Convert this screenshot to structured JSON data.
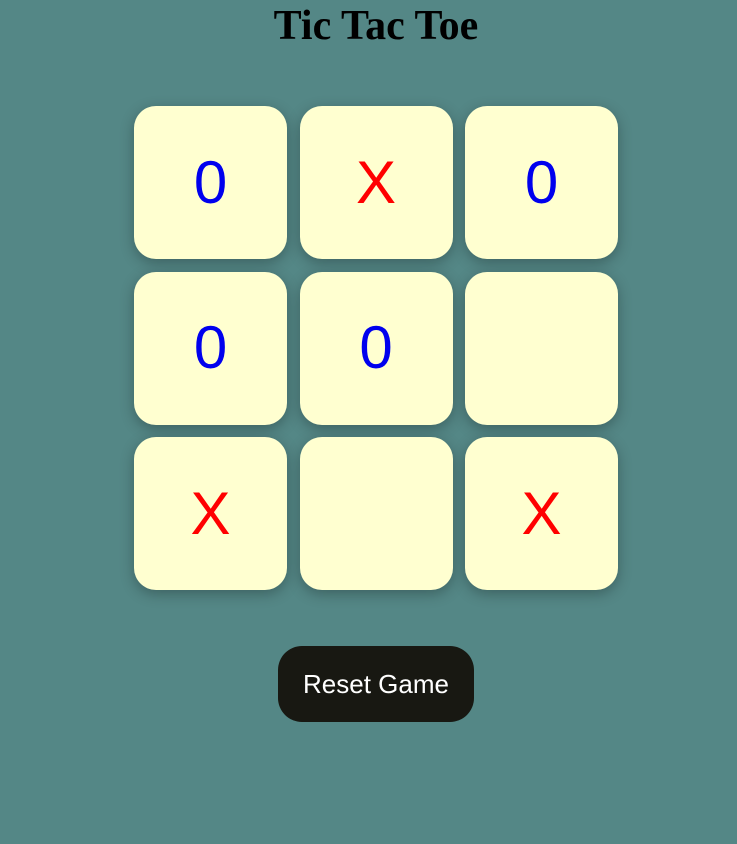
{
  "title": "Tic Tac Toe",
  "board": {
    "cells": [
      "0",
      "X",
      "0",
      "0",
      "0",
      "",
      "X",
      "",
      "X"
    ]
  },
  "colors": {
    "background": "#548786",
    "cell_background": "#ffffd0",
    "x_mark": "#ff0000",
    "o_mark": "#0000ee",
    "button_background": "#181812",
    "button_text": "#ffffff"
  },
  "reset_button": {
    "label": "Reset Game"
  }
}
